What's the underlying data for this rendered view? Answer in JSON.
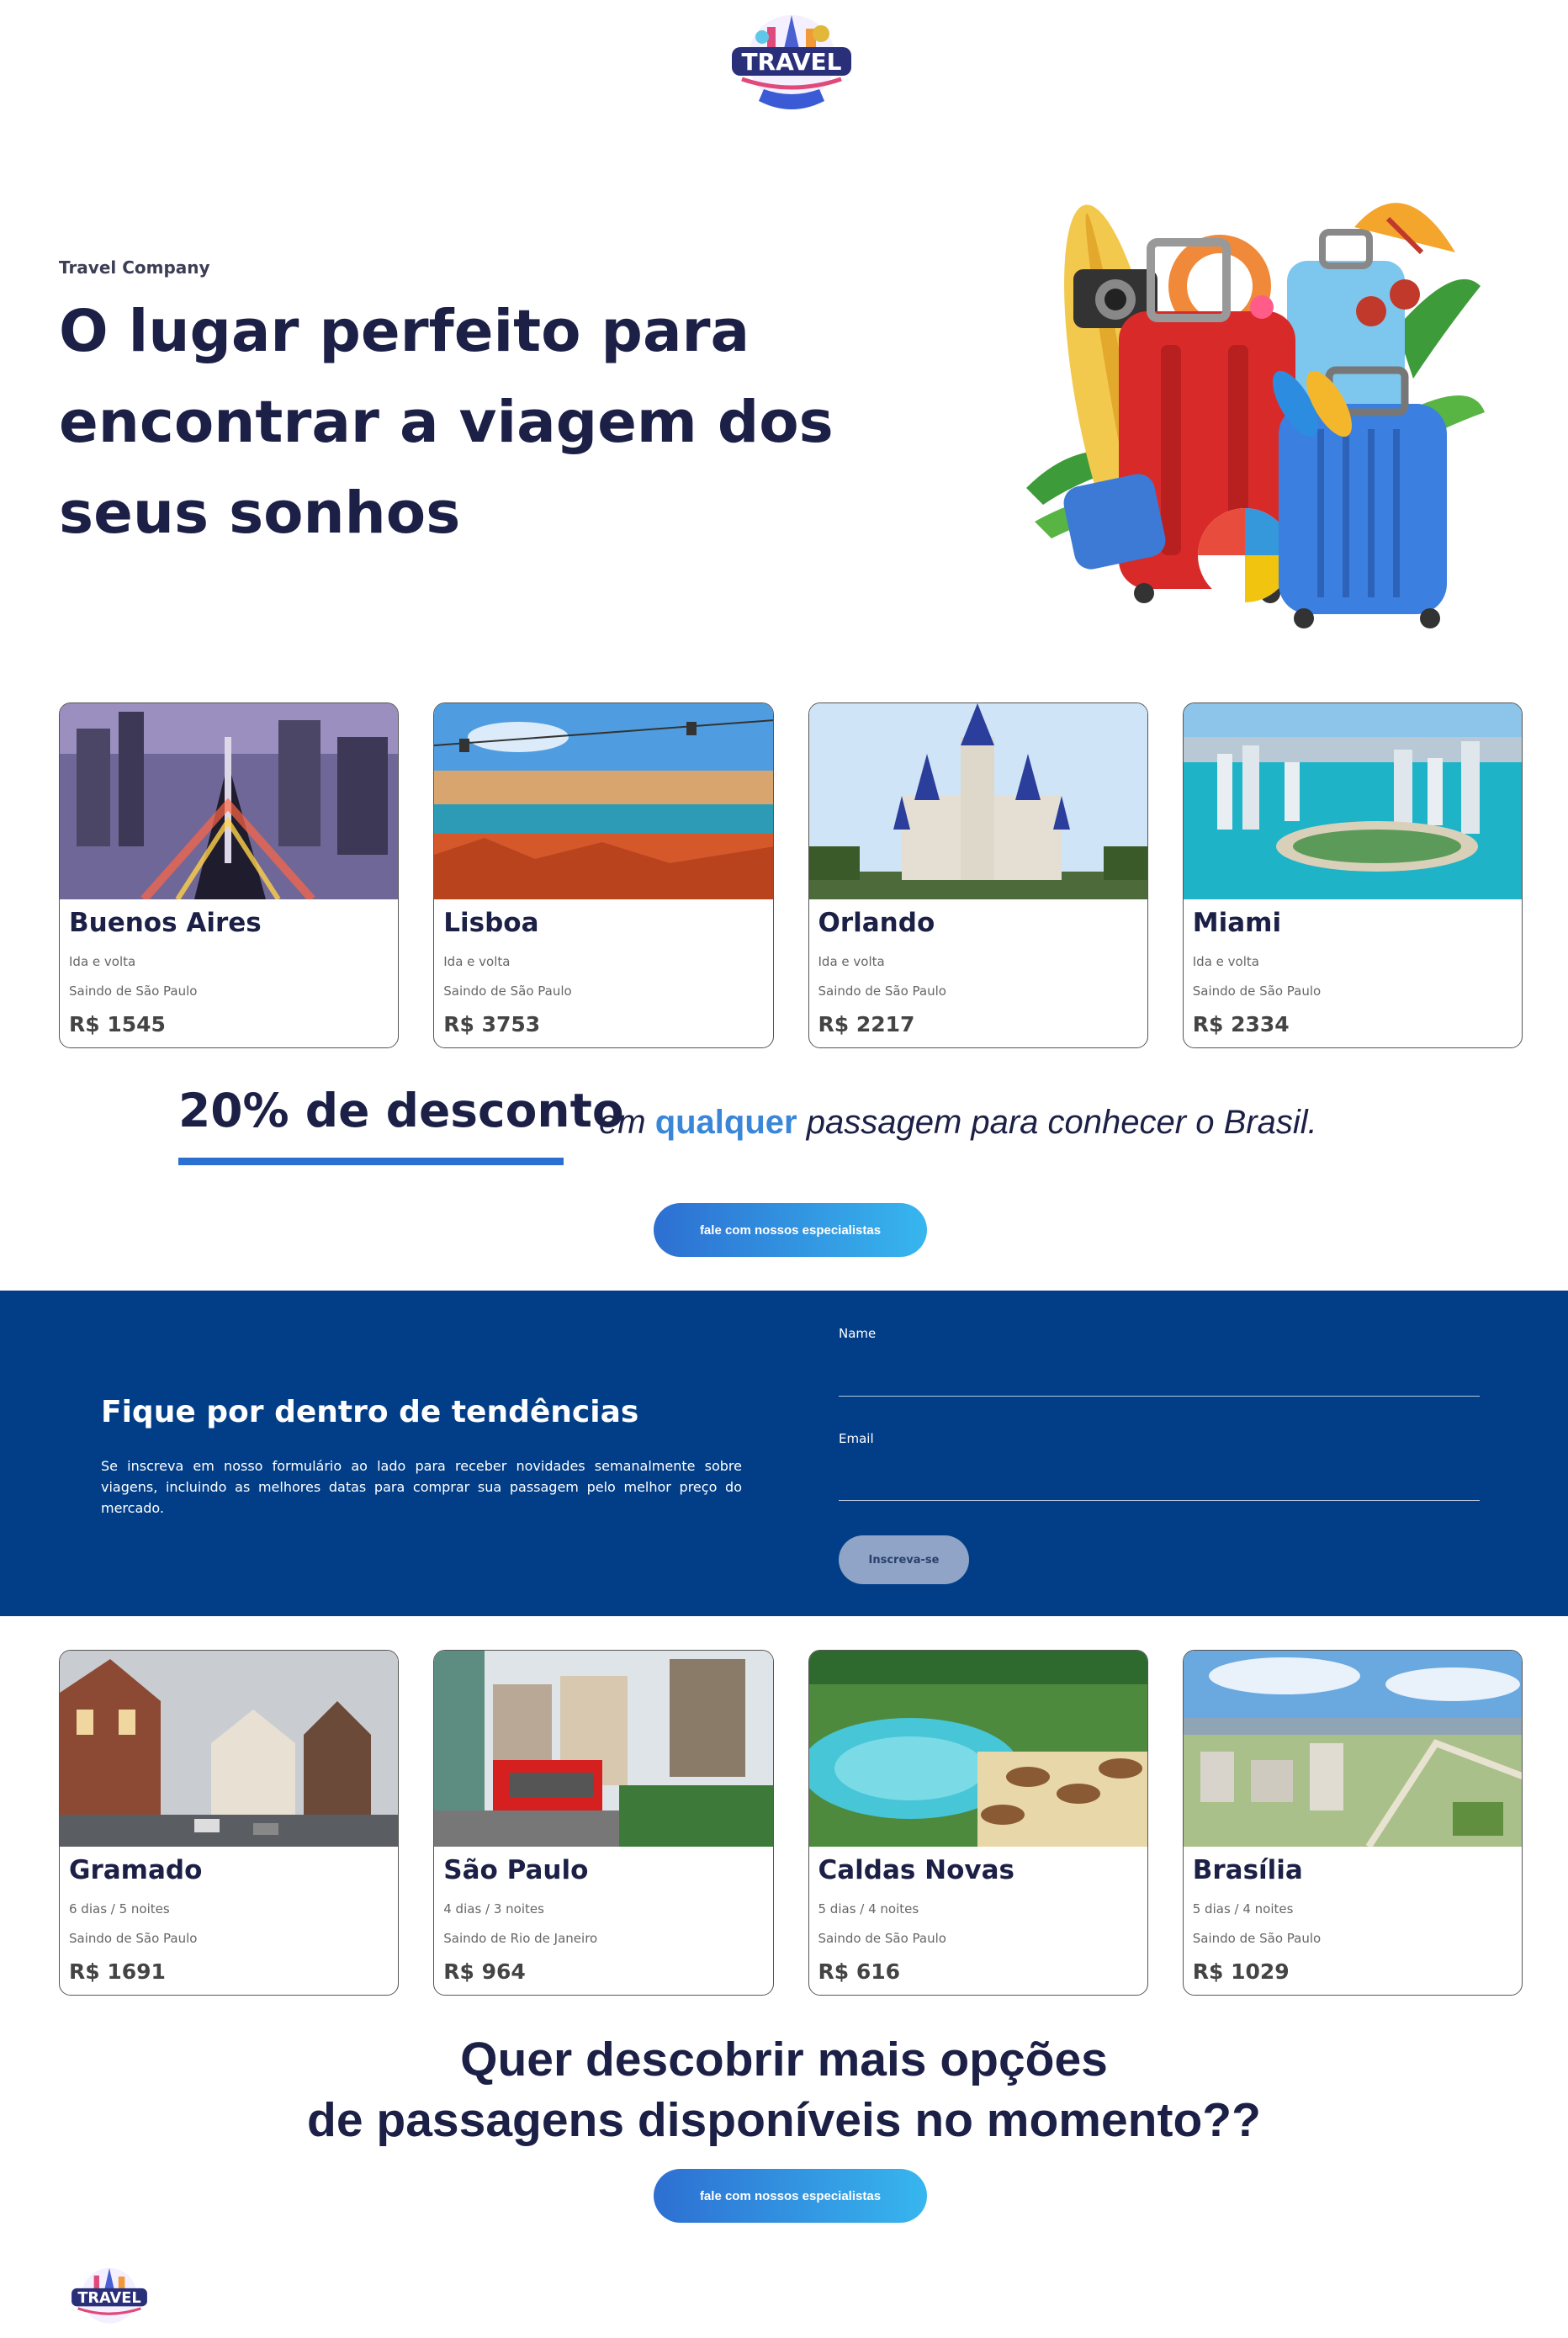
{
  "header": {
    "logo_text": "TRAVEL"
  },
  "hero": {
    "kicker": "Travel Company",
    "title": "O lugar perfeito para encontrar a viagem dos seus sonhos"
  },
  "international_cards": [
    {
      "city": "Buenos Aires",
      "line1": "Ida e volta",
      "line2": "Saindo de São Paulo",
      "price": "R$ 1545"
    },
    {
      "city": "Lisboa",
      "line1": "Ida e volta",
      "line2": "Saindo de São Paulo",
      "price": "R$ 3753"
    },
    {
      "city": "Orlando",
      "line1": "Ida e volta",
      "line2": "Saindo de São Paulo",
      "price": "R$ 2217"
    },
    {
      "city": "Miami",
      "line1": "Ida e volta",
      "line2": "Saindo de São Paulo",
      "price": "R$ 2334"
    }
  ],
  "promo": {
    "headline": "20% de desconto",
    "text_before": "em ",
    "highlight": "qualquer",
    "text_after": " passagem para conhecer o Brasil.",
    "button_label": "fale com nossos especialistas"
  },
  "newsletter": {
    "title": "Fique por dentro de tendências",
    "description": "Se inscreva em nosso formulário ao lado para receber novidades semanalmente sobre viagens, incluindo as melhores datas para comprar sua passagem pelo melhor preço do mercado.",
    "name_label": "Name",
    "email_label": "Email",
    "submit_label": "Inscreva-se"
  },
  "national_cards": [
    {
      "city": "Gramado",
      "line1": "6 dias / 5 noites",
      "line2": "Saindo de São Paulo",
      "price": "R$ 1691"
    },
    {
      "city": "São Paulo",
      "line1": "4 dias / 3 noites",
      "line2": "Saindo de Rio de Janeiro",
      "price": "R$ 964"
    },
    {
      "city": "Caldas Novas",
      "line1": "5 dias / 4 noites",
      "line2": "Saindo de São Paulo",
      "price": "R$ 616"
    },
    {
      "city": "Brasília",
      "line1": "5 dias / 4 noites",
      "line2": "Saindo de São Paulo",
      "price": "R$ 1029"
    }
  ],
  "cta": {
    "line1": "Quer descobrir mais opções",
    "line2": "de passagens disponíveis no momento??",
    "button_label": "fale com nossos especialistas"
  },
  "colors": {
    "navy": "#1c2046",
    "band": "#023e88",
    "accent": "#2b6fd1",
    "accent2": "#37b6ee"
  }
}
